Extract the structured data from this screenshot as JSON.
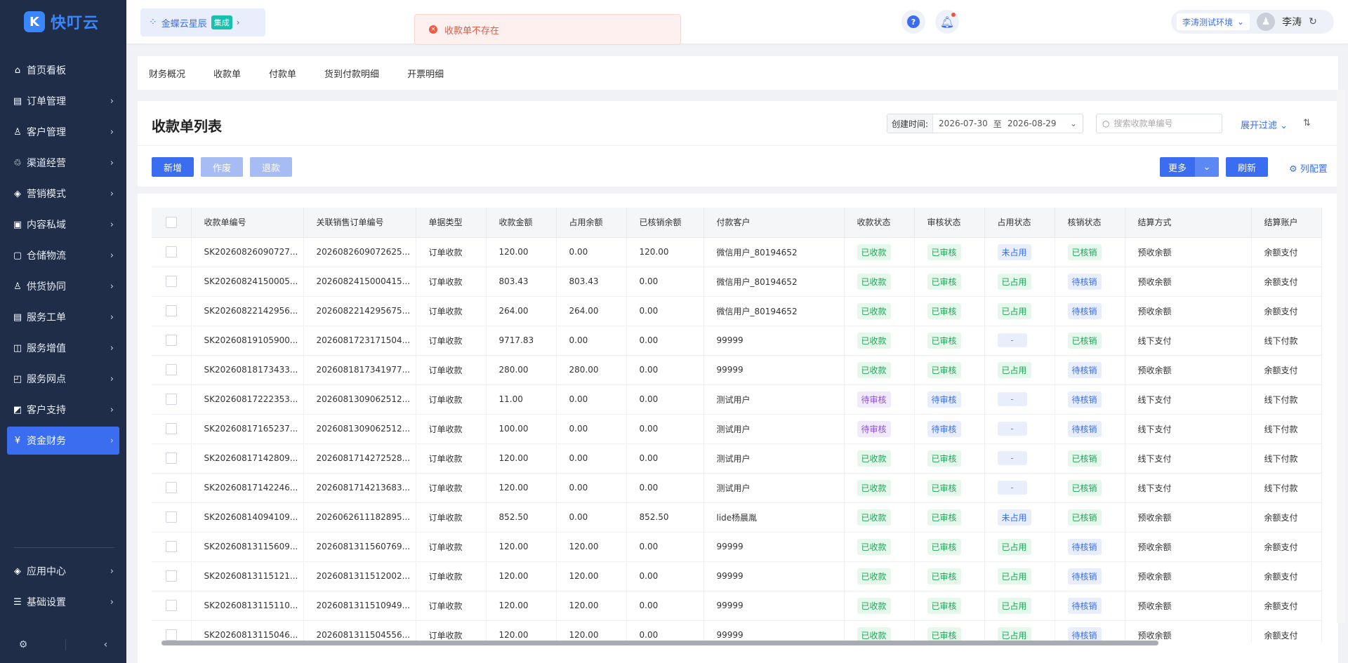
{
  "app": {
    "logo_text": "快叮云",
    "logo_mark": "K"
  },
  "header": {
    "brand_name": "金蝶云星辰",
    "brand_badge": "集成",
    "toast_message": "收款单不存在",
    "env_label": "李涛测试环境",
    "user_name": "李涛"
  },
  "sidebar": {
    "items": [
      {
        "label": "首页看板",
        "icon": "home-icon",
        "glyph": "⌂",
        "arrow": ""
      },
      {
        "label": "订单管理",
        "icon": "order-icon",
        "glyph": "▤",
        "arrow": "›"
      },
      {
        "label": "客户管理",
        "icon": "user-icon",
        "glyph": "♙",
        "arrow": "›"
      },
      {
        "label": "渠道经营",
        "icon": "channel-icon",
        "glyph": "♲",
        "arrow": "›"
      },
      {
        "label": "营销模式",
        "icon": "tag-icon",
        "glyph": "◈",
        "arrow": "›"
      },
      {
        "label": "内容私域",
        "icon": "image-icon",
        "glyph": "▣",
        "arrow": "›"
      },
      {
        "label": "仓储物流",
        "icon": "warehouse-icon",
        "glyph": "▢",
        "arrow": "›"
      },
      {
        "label": "供货协同",
        "icon": "supply-icon",
        "glyph": "♙",
        "arrow": "›"
      },
      {
        "label": "服务工单",
        "icon": "ticket-icon",
        "glyph": "▤",
        "arrow": "›"
      },
      {
        "label": "服务增值",
        "icon": "gift-icon",
        "glyph": "◫",
        "arrow": "›"
      },
      {
        "label": "服务网点",
        "icon": "store-icon",
        "glyph": "◰",
        "arrow": "›"
      },
      {
        "label": "客户支持",
        "icon": "support-icon",
        "glyph": "◩",
        "arrow": "›"
      },
      {
        "label": "资金财务",
        "icon": "finance-icon",
        "glyph": "¥",
        "arrow": "›"
      }
    ],
    "bottom_items": [
      {
        "label": "应用中心",
        "icon": "app-center-icon",
        "glyph": "◈",
        "arrow": "›"
      },
      {
        "label": "基础设置",
        "icon": "settings-icon",
        "glyph": "☰",
        "arrow": "›"
      }
    ],
    "active_label": "资金财务"
  },
  "tabs": [
    "财务概况",
    "收款单",
    "付款单",
    "货到付款明细",
    "开票明细"
  ],
  "page": {
    "title": "收款单列表",
    "date_label": "创建时间:",
    "date_start": "2026-07-30",
    "date_sep": "至",
    "date_end": "2026-08-29",
    "search_placeholder": "搜索收款单编号",
    "expand_filter": "展开过滤",
    "toolbar": {
      "add": "新增",
      "void": "作废",
      "refund": "退款",
      "more": "更多",
      "refresh": "刷新",
      "column_config": "列配置"
    }
  },
  "table": {
    "columns": [
      "收款单编号",
      "关联销售订单编号",
      "单据类型",
      "收款金额",
      "占用余额",
      "已核销余额",
      "付款客户",
      "收款状态",
      "审核状态",
      "占用状态",
      "核销状态",
      "结算方式",
      "结算账户"
    ],
    "rows": [
      [
        "SK20260826090727...",
        "2026082609072625...",
        "订单收款",
        "120.00",
        "0.00",
        "120.00",
        "微信用户_80194652",
        "已收款",
        "已审核",
        "未占用",
        "已核销",
        "预收余额",
        "余额支付"
      ],
      [
        "SK20260824150005...",
        "2026082415000415...",
        "订单收款",
        "803.43",
        "803.43",
        "0.00",
        "微信用户_80194652",
        "已收款",
        "已审核",
        "已占用",
        "待核销",
        "预收余额",
        "余额支付"
      ],
      [
        "SK20260822142956...",
        "2026082214295675...",
        "订单收款",
        "264.00",
        "264.00",
        "0.00",
        "微信用户_80194652",
        "已收款",
        "已审核",
        "已占用",
        "待核销",
        "预收余额",
        "余额支付"
      ],
      [
        "SK20260819105900...",
        "2026081723171504...",
        "订单收款",
        "9717.83",
        "0.00",
        "0.00",
        "99999",
        "已收款",
        "已审核",
        "-",
        "已核销",
        "线下支付",
        "线下付款"
      ],
      [
        "SK20260818173433...",
        "2026081817341977...",
        "订单收款",
        "280.00",
        "280.00",
        "0.00",
        "99999",
        "已收款",
        "已审核",
        "已占用",
        "待核销",
        "预收余额",
        "余额支付"
      ],
      [
        "SK20260817222353...",
        "2026081309062512...",
        "订单收款",
        "11.00",
        "0.00",
        "0.00",
        "测试用户",
        "待审核",
        "待审核",
        "-",
        "待核销",
        "线下支付",
        "线下付款"
      ],
      [
        "SK20260817165237...",
        "2026081309062512...",
        "订单收款",
        "100.00",
        "0.00",
        "0.00",
        "测试用户",
        "待审核",
        "待审核",
        "-",
        "待核销",
        "线下支付",
        "线下付款"
      ],
      [
        "SK20260817142809...",
        "2026081714272528...",
        "订单收款",
        "120.00",
        "0.00",
        "0.00",
        "测试用户",
        "已收款",
        "已审核",
        "-",
        "已核销",
        "线下支付",
        "线下付款"
      ],
      [
        "SK20260817142246...",
        "2026081714213683...",
        "订单收款",
        "120.00",
        "0.00",
        "0.00",
        "测试用户",
        "已收款",
        "已审核",
        "-",
        "已核销",
        "线下支付",
        "线下付款"
      ],
      [
        "SK20260814094109...",
        "2026062611182895...",
        "订单收款",
        "852.50",
        "0.00",
        "852.50",
        "lide杨晨胤",
        "已收款",
        "已审核",
        "未占用",
        "已核销",
        "预收余额",
        "余额支付"
      ],
      [
        "SK20260813115609...",
        "2026081311560769...",
        "订单收款",
        "120.00",
        "120.00",
        "0.00",
        "99999",
        "已收款",
        "已审核",
        "已占用",
        "待核销",
        "预收余额",
        "余额支付"
      ],
      [
        "SK20260813115121...",
        "2026081311512002...",
        "订单收款",
        "120.00",
        "120.00",
        "0.00",
        "99999",
        "已收款",
        "已审核",
        "已占用",
        "待核销",
        "预收余额",
        "余额支付"
      ],
      [
        "SK20260813115110...",
        "2026081311510949...",
        "订单收款",
        "120.00",
        "120.00",
        "0.00",
        "99999",
        "已收款",
        "已审核",
        "已占用",
        "待核销",
        "预收余额",
        "余额支付"
      ],
      [
        "SK20260813115046...",
        "2026081311504556...",
        "订单收款",
        "120.00",
        "120.00",
        "0.00",
        "99999",
        "已收款",
        "已审核",
        "已占用",
        "待核销",
        "预收余额",
        "余额支付"
      ]
    ],
    "tag_colors": {
      "已收款": "t-green",
      "已审核": "t-green",
      "已核销": "t-green",
      "待审核": "t-purple",
      "未占用": "t-blue",
      "已占用": "t-green",
      "待核销": "t-blue",
      "-": "t-grey"
    },
    "tag_hint": {
      "收款状态_待审核": "t-purple",
      "审核状态_待审核": "t-blue"
    }
  },
  "colors": {
    "primary": "#3a6df0",
    "sidebar_bg": "#1f2d48",
    "toast_text": "#e25b45"
  }
}
